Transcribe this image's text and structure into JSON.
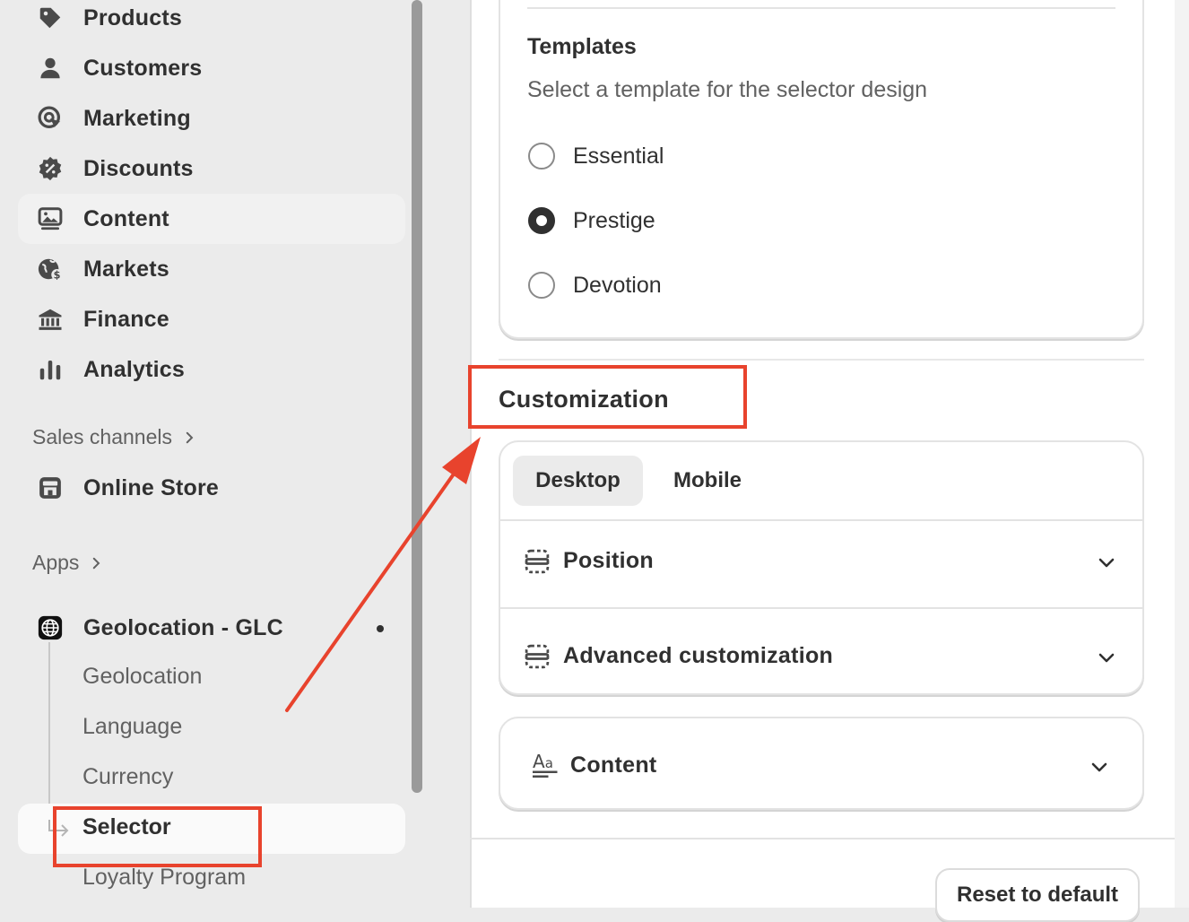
{
  "sidebar": {
    "nav": [
      {
        "label": "Products",
        "icon": "tag-icon"
      },
      {
        "label": "Customers",
        "icon": "person-icon"
      },
      {
        "label": "Marketing",
        "icon": "target-icon"
      },
      {
        "label": "Discounts",
        "icon": "discount-icon"
      },
      {
        "label": "Content",
        "icon": "image-icon"
      },
      {
        "label": "Markets",
        "icon": "globe-icon"
      },
      {
        "label": "Finance",
        "icon": "bank-icon"
      },
      {
        "label": "Analytics",
        "icon": "bar-chart-icon"
      }
    ],
    "sales_channels_label": "Sales channels",
    "online_store_label": "Online Store",
    "apps_label": "Apps",
    "app": {
      "name": "Geolocation - GLC",
      "subitems": [
        "Geolocation",
        "Language",
        "Currency",
        "Selector",
        "Loyalty Program"
      ]
    }
  },
  "main": {
    "templates": {
      "title": "Templates",
      "subtitle": "Select a template for the selector design",
      "options": [
        "Essential",
        "Prestige",
        "Devotion"
      ],
      "selected": "Prestige"
    },
    "customization": {
      "title": "Customization",
      "tabs": [
        "Desktop",
        "Mobile"
      ],
      "active_tab": "Desktop",
      "sections": [
        "Position",
        "Advanced customization"
      ]
    },
    "content_section": "Content",
    "reset_button": "Reset to default"
  },
  "colors": {
    "annotation": "#e8432d",
    "text_primary": "#303030",
    "text_secondary": "#616161"
  }
}
